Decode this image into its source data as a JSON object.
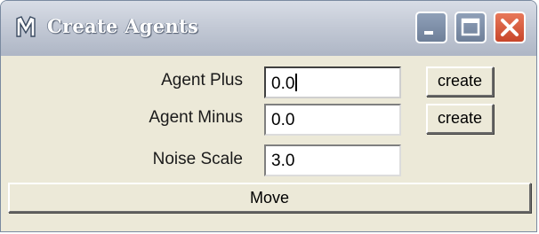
{
  "window": {
    "title": "Create Agents",
    "icon": "maya-m-icon",
    "controls": [
      "minimize-icon",
      "maximize-icon",
      "close-icon"
    ]
  },
  "rows": [
    {
      "label": "Agent Plus",
      "value": "0.0",
      "button": "create"
    },
    {
      "label": "Agent Minus",
      "value": "0.0",
      "button": "create"
    },
    {
      "label": "Noise Scale",
      "value": "3.0"
    }
  ],
  "actions": {
    "move_label": "Move"
  },
  "colors": {
    "panel": "#ece9d8",
    "titlebar": "#c4cad6",
    "close": "#d8563a"
  }
}
